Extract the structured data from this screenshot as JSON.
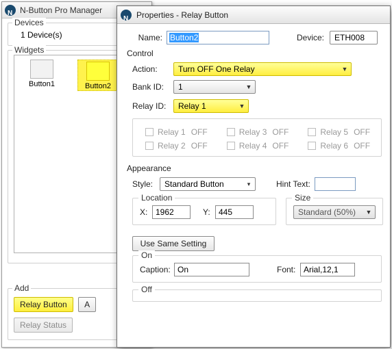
{
  "manager": {
    "title": "N-Button Pro Manager",
    "devices_legend": "Devices",
    "devices_count": "1 Device(s)",
    "widgets_legend": "Widgets",
    "widgets": [
      {
        "label": "Button1"
      },
      {
        "label": "Button2"
      }
    ],
    "add_legend": "Add",
    "relay_button_label": "Relay Button",
    "relay_status_label": "Relay Status",
    "partial_a": "A"
  },
  "props": {
    "title": "Properties - Relay Button",
    "name_label": "Name:",
    "name_value": "Button2",
    "device_label": "Device:",
    "device_value": "ETH008",
    "control_legend": "Control",
    "action_label": "Action:",
    "action_value": "Turn OFF One Relay",
    "bankid_label": "Bank ID:",
    "bankid_value": "1",
    "relayid_label": "Relay ID:",
    "relayid_value": "Relay 1",
    "relays": [
      {
        "name": "Relay 1",
        "state": "OFF"
      },
      {
        "name": "Relay 2",
        "state": "OFF"
      },
      {
        "name": "Relay 3",
        "state": "OFF"
      },
      {
        "name": "Relay 4",
        "state": "OFF"
      },
      {
        "name": "Relay 5",
        "state": "OFF"
      },
      {
        "name": "Relay 6",
        "state": "OFF"
      }
    ],
    "appearance_legend": "Appearance",
    "style_label": "Style:",
    "style_value": "Standard Button",
    "hint_label": "Hint Text:",
    "hint_value": "",
    "location_legend": "Location",
    "x_label": "X:",
    "x_value": "1962",
    "y_label": "Y:",
    "y_value": "445",
    "size_legend": "Size",
    "size_value": "Standard   (50%)",
    "use_same_label": "Use Same Setting",
    "on_legend": "On",
    "caption_label": "Caption:",
    "caption_value": "On",
    "font_label": "Font:",
    "font_value": "Arial,12,1",
    "off_legend": "Off"
  }
}
